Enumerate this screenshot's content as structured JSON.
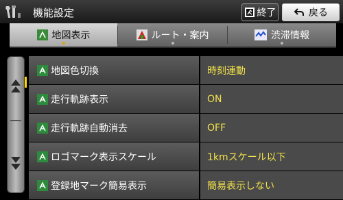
{
  "header": {
    "title": "機能設定",
    "end_label": "終了",
    "back_label": "戻る"
  },
  "tabs": [
    {
      "label": "地図表示",
      "active": true
    },
    {
      "label": "ルート・案内",
      "active": false
    },
    {
      "label": "渋滞情報",
      "active": false
    }
  ],
  "rows": [
    {
      "label": "地図色切換",
      "value": "時刻連動"
    },
    {
      "label": "走行軌跡表示",
      "value": "ON"
    },
    {
      "label": "走行軌跡自動消去",
      "value": "OFF"
    },
    {
      "label": "ロゴマーク表示スケール",
      "value": "1kmスケール以下"
    },
    {
      "label": "登録地マーク簡易表示",
      "value": "簡易表示しない"
    }
  ],
  "colors": {
    "value_text": "#f0e04a",
    "active_indicator": "#ffd500"
  },
  "icons": {
    "header": "wrench-settings-icon",
    "end": "exit-icon",
    "back": "back-arrow-icon",
    "row": "green-arrow-icon",
    "tab_map": "map-icon",
    "tab_route": "route-icon",
    "tab_traffic": "traffic-icon"
  }
}
